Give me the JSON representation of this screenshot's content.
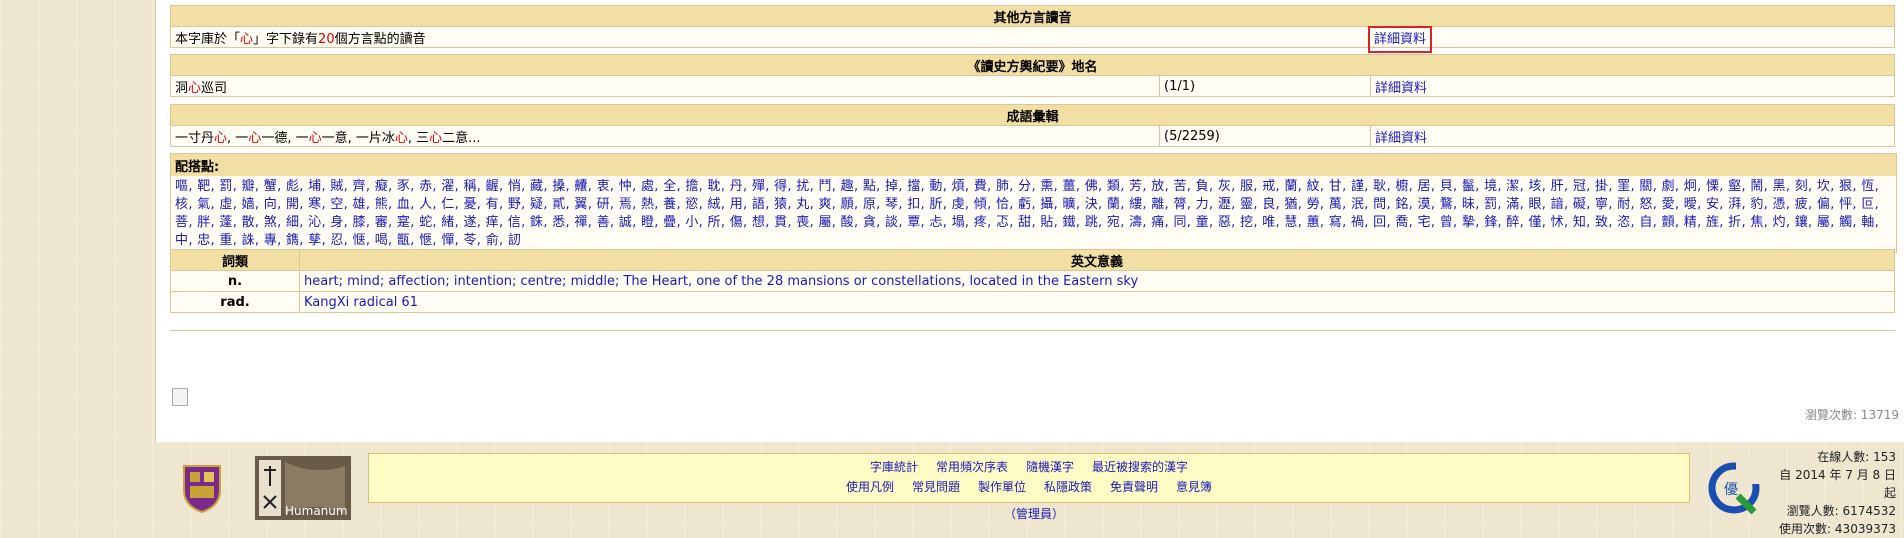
{
  "dialects": {
    "header": "其他方言讀音",
    "row": {
      "prefix": "本字庫於「",
      "char": "心",
      "mid": "」字下錄有",
      "count": "20",
      "suffix": "個方言點的讀音"
    },
    "link": "詳細資料"
  },
  "placenames": {
    "header": "《讀史方輿紀要》地名",
    "row": {
      "pre": "洞",
      "char": "心",
      "post": "巡司",
      "count": "(1/1)",
      "link": "詳細資料"
    }
  },
  "idioms": {
    "header": "成語彙輯",
    "row": {
      "parts": [
        {
          "t": "一寸丹",
          "r": false
        },
        {
          "t": "心",
          "r": true
        },
        {
          "t": ", 一",
          "r": false
        },
        {
          "t": "心",
          "r": true
        },
        {
          "t": "一德, 一",
          "r": false
        },
        {
          "t": "心",
          "r": true
        },
        {
          "t": "一意, 一片冰",
          "r": false
        },
        {
          "t": "心",
          "r": true
        },
        {
          "t": ", 三",
          "r": false
        },
        {
          "t": "心",
          "r": true
        },
        {
          "t": "二意...",
          "r": false
        }
      ],
      "count": "(5/2259)",
      "link": "詳細資料"
    }
  },
  "pairs": {
    "title": "配搭點:",
    "items": [
      "嘔",
      "靶",
      "罰",
      "瓣",
      "蟹",
      "彪",
      "埔",
      "賊",
      "齊",
      "癡",
      "豕",
      "赤",
      "濯",
      "稱",
      "齷",
      "悄",
      "藏",
      "搡",
      "齉",
      "衷",
      "忡",
      "處",
      "全",
      "擔",
      "耽",
      "丹",
      "殫",
      "得",
      "扰",
      "鬥",
      "趣",
      "點",
      "掉",
      "擋",
      "動",
      "煩",
      "費",
      "肺",
      "分",
      "熏",
      "薑",
      "佛",
      "類",
      "芳",
      "放",
      "苦",
      "負",
      "灰",
      "服",
      "戒",
      "蘭",
      "紋",
      "甘",
      "謹",
      "耿",
      "櫥",
      "居",
      "貝",
      "鬣",
      "境",
      "潔",
      "垓",
      "肝",
      "冠",
      "掛",
      "罣",
      "關",
      "劇",
      "炯",
      "慄",
      "壑",
      "鬧",
      "黑",
      "刻",
      "坎",
      "狠",
      "恆",
      "核",
      "氣",
      "虛",
      "嫱",
      "向",
      "開",
      "寒",
      "空",
      "雄",
      "熊",
      "血",
      "人",
      "仁",
      "憂",
      "有",
      "野",
      "疑",
      "貳",
      "翼",
      "研",
      "焉",
      "熱",
      "養",
      "慾",
      "絨",
      "用",
      "語",
      "猿",
      "丸",
      "爽",
      "願",
      "原",
      "琴",
      "扣",
      "肵",
      "虔",
      "傾",
      "恰",
      "虧",
      "攝",
      "曠",
      "決",
      "蘭",
      "縷",
      "離",
      "膂",
      "力",
      "瀝",
      "靈",
      "良",
      "猶",
      "勞",
      "萬",
      "泯",
      "問",
      "銘",
      "漠",
      "鶩",
      "昧",
      "罰",
      "滿",
      "眼",
      "諳",
      "礙",
      "寧",
      "耐",
      "怒",
      "愛",
      "曖",
      "安",
      "湃",
      "豹",
      "憑",
      "疲",
      "偏",
      "怦",
      "叵",
      "菩",
      "胖",
      "蓬",
      "散",
      "煞",
      "細",
      "沁",
      "身",
      "膝",
      "審",
      "寔",
      "蛇",
      "緒",
      "遂",
      "痒",
      "信",
      "銖",
      "悉",
      "禪",
      "善",
      "誠",
      "瞪",
      "疊",
      "小",
      "所",
      "傷",
      "想",
      "貫",
      "喪",
      "屬",
      "酸",
      "貪",
      "談",
      "覃",
      "忐",
      "塌",
      "疼",
      "忑",
      "甜",
      "貼",
      "鐵",
      "跳",
      "宛",
      "濤",
      "痛",
      "同",
      "童",
      "惡",
      "挖",
      "唯",
      "慧",
      "蕙",
      "寫",
      "禍",
      "回",
      "喬",
      "宅",
      "曾",
      "摯",
      "鋒",
      "醉",
      "僅",
      "怵",
      "知",
      "致",
      "恣",
      "自",
      "顫",
      "精",
      "旌",
      "折",
      "焦",
      "灼",
      "鑲",
      "屬",
      "觸",
      "軸",
      "中",
      "忠",
      "重",
      "誅",
      "專",
      "鐫",
      "孳",
      "忍",
      "惬",
      "喝",
      "甑",
      "愜",
      "憚",
      "苓",
      "俞",
      "訒"
    ]
  },
  "english": {
    "headers": [
      "詞類",
      "英文意義"
    ],
    "rows": [
      {
        "pos": "n.",
        "meaning": "heart; mind; affection; intention; centre; middle; The Heart, one of the 28 mansions or constellations, located in the Eastern sky"
      },
      {
        "pos": "rad.",
        "meaning": "KangXi radical 61"
      }
    ]
  },
  "browse_count": "瀏覽次數: 13719",
  "footer": {
    "row1": [
      "字庫統計",
      "常用頻次序表",
      "隨機漢字",
      "最近被搜索的漢字"
    ],
    "row2": [
      "使用凡例",
      "常見問題",
      "製作單位",
      "私隱政策",
      "免責聲明",
      "意見簿"
    ],
    "admin": "（管理員）"
  },
  "logo2_text": "Humanum",
  "right_stats": {
    "online": "在線人數:",
    "online_val": "153",
    "since": "自 2014 年 7 月 8 日起",
    "visitors": "瀏覽人數:",
    "visitors_val": "6174532",
    "uses": "使用次數:",
    "uses_val": "43039373"
  }
}
